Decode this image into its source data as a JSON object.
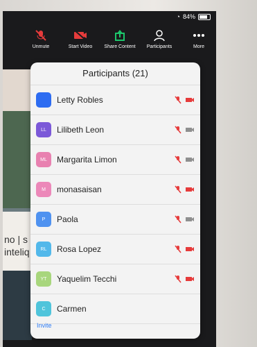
{
  "status": {
    "battery": "84%"
  },
  "toolbar": {
    "unmute": "Unmute",
    "start_video": "Start Video",
    "share_content": "Share Content",
    "participants": "Participants",
    "more": "More"
  },
  "background": {
    "text": "no | s\ninteliq"
  },
  "panel": {
    "title": "Participants (21)",
    "invite": "Invite",
    "participants": [
      {
        "name": "Letty Robles",
        "initials": "",
        "color": "#2d6cf1",
        "mic_muted": true,
        "video_off": true
      },
      {
        "name": "Lilibeth Leon",
        "initials": "LL",
        "color": "#7b58d8",
        "mic_muted": true,
        "video_off": false
      },
      {
        "name": "Margarita Limon",
        "initials": "ML",
        "color": "#e881b0",
        "mic_muted": true,
        "video_off": false
      },
      {
        "name": "monasaisan",
        "initials": "M",
        "color": "#ec88b9",
        "mic_muted": true,
        "video_off": true
      },
      {
        "name": "Paola",
        "initials": "P",
        "color": "#4f92f0",
        "mic_muted": true,
        "video_off": false
      },
      {
        "name": "Rosa Lopez",
        "initials": "RL",
        "color": "#52b8ea",
        "mic_muted": true,
        "video_off": true
      },
      {
        "name": "Yaquelim Tecchi",
        "initials": "YT",
        "color": "#a8d67d",
        "mic_muted": true,
        "video_off": true
      },
      {
        "name": "Carmen",
        "initials": "C",
        "color": "#4fc4db",
        "mic_muted": false,
        "video_off": false
      }
    ]
  }
}
